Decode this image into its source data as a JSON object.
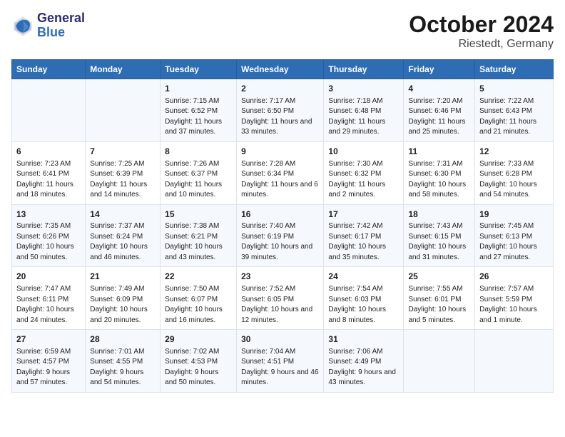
{
  "header": {
    "logo_line1": "General",
    "logo_line2": "Blue",
    "title": "October 2024",
    "subtitle": "Riestedt, Germany"
  },
  "days_of_week": [
    "Sunday",
    "Monday",
    "Tuesday",
    "Wednesday",
    "Thursday",
    "Friday",
    "Saturday"
  ],
  "weeks": [
    {
      "cells": [
        {
          "day": "",
          "content": ""
        },
        {
          "day": "",
          "content": ""
        },
        {
          "day": "1",
          "content": "Sunrise: 7:15 AM\nSunset: 6:52 PM\nDaylight: 11 hours\nand 37 minutes."
        },
        {
          "day": "2",
          "content": "Sunrise: 7:17 AM\nSunset: 6:50 PM\nDaylight: 11 hours\nand 33 minutes."
        },
        {
          "day": "3",
          "content": "Sunrise: 7:18 AM\nSunset: 6:48 PM\nDaylight: 11 hours\nand 29 minutes."
        },
        {
          "day": "4",
          "content": "Sunrise: 7:20 AM\nSunset: 6:46 PM\nDaylight: 11 hours\nand 25 minutes."
        },
        {
          "day": "5",
          "content": "Sunrise: 7:22 AM\nSunset: 6:43 PM\nDaylight: 11 hours\nand 21 minutes."
        }
      ]
    },
    {
      "cells": [
        {
          "day": "6",
          "content": "Sunrise: 7:23 AM\nSunset: 6:41 PM\nDaylight: 11 hours\nand 18 minutes."
        },
        {
          "day": "7",
          "content": "Sunrise: 7:25 AM\nSunset: 6:39 PM\nDaylight: 11 hours\nand 14 minutes."
        },
        {
          "day": "8",
          "content": "Sunrise: 7:26 AM\nSunset: 6:37 PM\nDaylight: 11 hours\nand 10 minutes."
        },
        {
          "day": "9",
          "content": "Sunrise: 7:28 AM\nSunset: 6:34 PM\nDaylight: 11 hours\nand 6 minutes."
        },
        {
          "day": "10",
          "content": "Sunrise: 7:30 AM\nSunset: 6:32 PM\nDaylight: 11 hours\nand 2 minutes."
        },
        {
          "day": "11",
          "content": "Sunrise: 7:31 AM\nSunset: 6:30 PM\nDaylight: 10 hours\nand 58 minutes."
        },
        {
          "day": "12",
          "content": "Sunrise: 7:33 AM\nSunset: 6:28 PM\nDaylight: 10 hours\nand 54 minutes."
        }
      ]
    },
    {
      "cells": [
        {
          "day": "13",
          "content": "Sunrise: 7:35 AM\nSunset: 6:26 PM\nDaylight: 10 hours\nand 50 minutes."
        },
        {
          "day": "14",
          "content": "Sunrise: 7:37 AM\nSunset: 6:24 PM\nDaylight: 10 hours\nand 46 minutes."
        },
        {
          "day": "15",
          "content": "Sunrise: 7:38 AM\nSunset: 6:21 PM\nDaylight: 10 hours\nand 43 minutes."
        },
        {
          "day": "16",
          "content": "Sunrise: 7:40 AM\nSunset: 6:19 PM\nDaylight: 10 hours\nand 39 minutes."
        },
        {
          "day": "17",
          "content": "Sunrise: 7:42 AM\nSunset: 6:17 PM\nDaylight: 10 hours\nand 35 minutes."
        },
        {
          "day": "18",
          "content": "Sunrise: 7:43 AM\nSunset: 6:15 PM\nDaylight: 10 hours\nand 31 minutes."
        },
        {
          "day": "19",
          "content": "Sunrise: 7:45 AM\nSunset: 6:13 PM\nDaylight: 10 hours\nand 27 minutes."
        }
      ]
    },
    {
      "cells": [
        {
          "day": "20",
          "content": "Sunrise: 7:47 AM\nSunset: 6:11 PM\nDaylight: 10 hours\nand 24 minutes."
        },
        {
          "day": "21",
          "content": "Sunrise: 7:49 AM\nSunset: 6:09 PM\nDaylight: 10 hours\nand 20 minutes."
        },
        {
          "day": "22",
          "content": "Sunrise: 7:50 AM\nSunset: 6:07 PM\nDaylight: 10 hours\nand 16 minutes."
        },
        {
          "day": "23",
          "content": "Sunrise: 7:52 AM\nSunset: 6:05 PM\nDaylight: 10 hours\nand 12 minutes."
        },
        {
          "day": "24",
          "content": "Sunrise: 7:54 AM\nSunset: 6:03 PM\nDaylight: 10 hours\nand 8 minutes."
        },
        {
          "day": "25",
          "content": "Sunrise: 7:55 AM\nSunset: 6:01 PM\nDaylight: 10 hours\nand 5 minutes."
        },
        {
          "day": "26",
          "content": "Sunrise: 7:57 AM\nSunset: 5:59 PM\nDaylight: 10 hours\nand 1 minute."
        }
      ]
    },
    {
      "cells": [
        {
          "day": "27",
          "content": "Sunrise: 6:59 AM\nSunset: 4:57 PM\nDaylight: 9 hours\nand 57 minutes."
        },
        {
          "day": "28",
          "content": "Sunrise: 7:01 AM\nSunset: 4:55 PM\nDaylight: 9 hours\nand 54 minutes."
        },
        {
          "day": "29",
          "content": "Sunrise: 7:02 AM\nSunset: 4:53 PM\nDaylight: 9 hours\nand 50 minutes."
        },
        {
          "day": "30",
          "content": "Sunrise: 7:04 AM\nSunset: 4:51 PM\nDaylight: 9 hours\nand 46 minutes."
        },
        {
          "day": "31",
          "content": "Sunrise: 7:06 AM\nSunset: 4:49 PM\nDaylight: 9 hours\nand 43 minutes."
        },
        {
          "day": "",
          "content": ""
        },
        {
          "day": "",
          "content": ""
        }
      ]
    }
  ]
}
